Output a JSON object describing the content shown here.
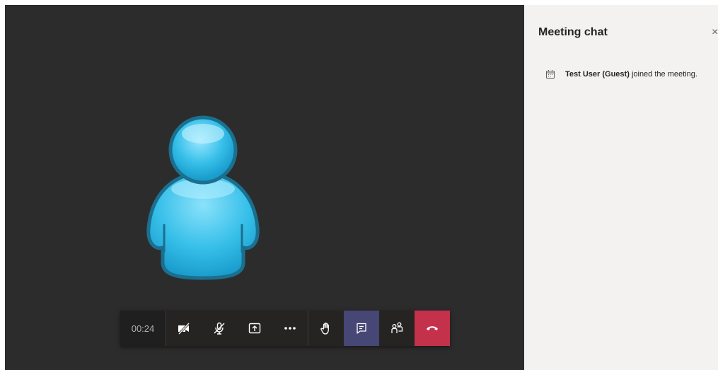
{
  "call": {
    "timer": "00:24",
    "controls": [
      {
        "name": "camera-off-button",
        "icon": "camera-off-icon"
      },
      {
        "name": "mic-muted-button",
        "icon": "mic-off-icon"
      },
      {
        "name": "share-screen-button",
        "icon": "share-icon"
      },
      {
        "name": "more-actions-button",
        "icon": "more-icon"
      },
      {
        "name": "raise-hand-button",
        "icon": "hand-icon"
      },
      {
        "name": "show-conversation-button",
        "icon": "chat-icon"
      },
      {
        "name": "participants-button",
        "icon": "people-icon"
      },
      {
        "name": "hang-up-button",
        "icon": "phone-hangup-icon"
      }
    ],
    "colors": {
      "stage_bg": "#2d2c2c",
      "active_bg": "#464775",
      "hangup_bg": "#c4314b",
      "avatar_fill": "#37c0ea",
      "avatar_outline": "#1b6f8f"
    }
  },
  "chat": {
    "title": "Meeting chat",
    "close": "×",
    "messages": [
      {
        "icon": "calendar-icon",
        "user": "Test User (Guest)",
        "text": "joined the meeting."
      }
    ]
  }
}
